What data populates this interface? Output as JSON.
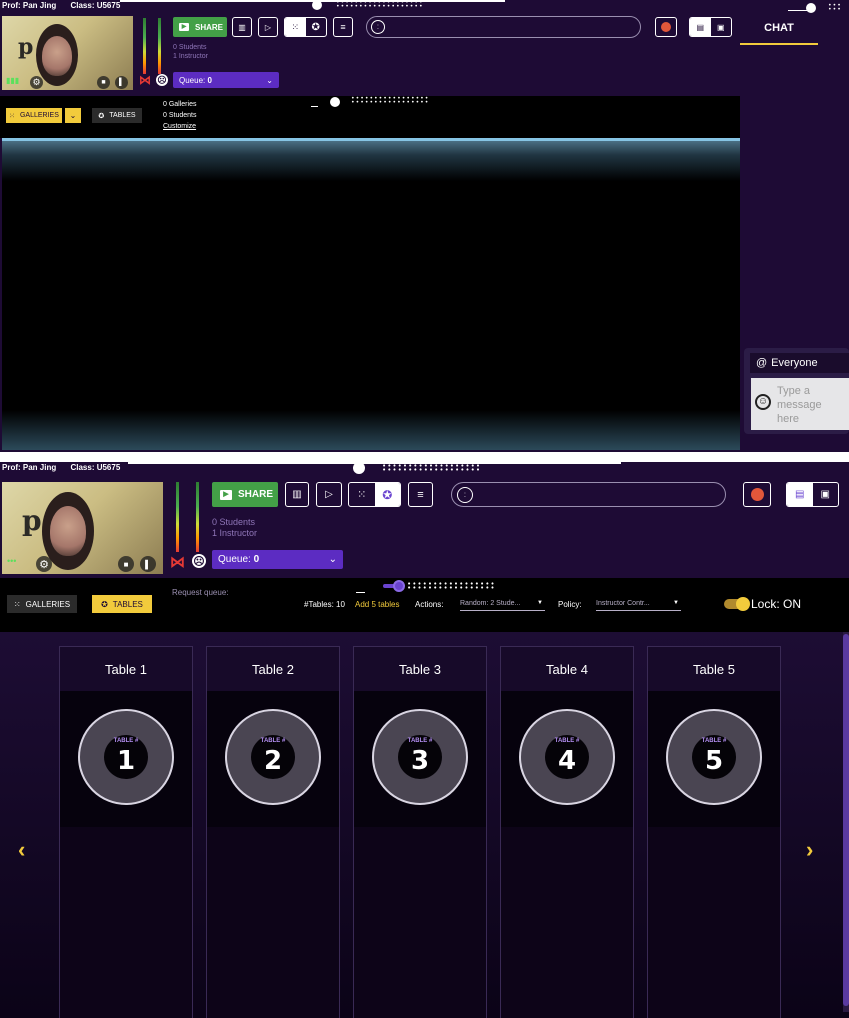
{
  "session": {
    "prof_label": "Prof: Pan Jing",
    "class_label": "Class: U5675"
  },
  "toolbar": {
    "share_label": "SHARE",
    "students_count": "0 Students",
    "instructor_count": "1 Instructor",
    "queue_label": "Queue:",
    "queue_value": "0"
  },
  "gallery_bar": {
    "galleries_label": "GALLERIES",
    "tables_label": "TABLES",
    "galleries_count": "0 Galleries",
    "students_count": "0 Students",
    "customize_label": "Customize"
  },
  "chat": {
    "tab_label": "CHAT",
    "recipient_label": "Everyone",
    "message_placeholder": "Type a message here"
  },
  "tables_bar": {
    "request_queue_label": "Request queue:",
    "tables_count_label": "#Tables: 10",
    "add_tables_label": "Add 5 tables",
    "actions_label": "Actions:",
    "actions_value": "Random: 2 Stude...",
    "policy_label": "Policy:",
    "policy_value": "Instructor Contr...",
    "lock_label": "Lock:",
    "lock_value": "ON"
  },
  "tables": [
    {
      "name": "Table 1",
      "tag": "TABLE #",
      "number": "1"
    },
    {
      "name": "Table 2",
      "tag": "TABLE #",
      "number": "2"
    },
    {
      "name": "Table 3",
      "tag": "TABLE #",
      "number": "3"
    },
    {
      "name": "Table 4",
      "tag": "TABLE #",
      "number": "4"
    },
    {
      "name": "Table 5",
      "tag": "TABLE #",
      "number": "5"
    }
  ],
  "colors": {
    "background": "#1e0b35",
    "share_green": "#43a047",
    "accent_yellow": "#f2cb3c",
    "queue_purple": "#5c2cc2",
    "record_red": "#e2573a",
    "stage_border": "#86c4e4"
  },
  "icons": {
    "share": "presentation-icon",
    "poll": "bar-chart-icon",
    "screen": "play-screen-icon",
    "grid": "grid-icon",
    "tables": "soccer-ball-icon",
    "menu": "menu-icon",
    "record": "record-icon",
    "chat": "chat-bubble-icon",
    "camera": "camera-icon",
    "mic": "mic-icon",
    "settings": "gear-icon",
    "emoji": "smiley-icon"
  }
}
